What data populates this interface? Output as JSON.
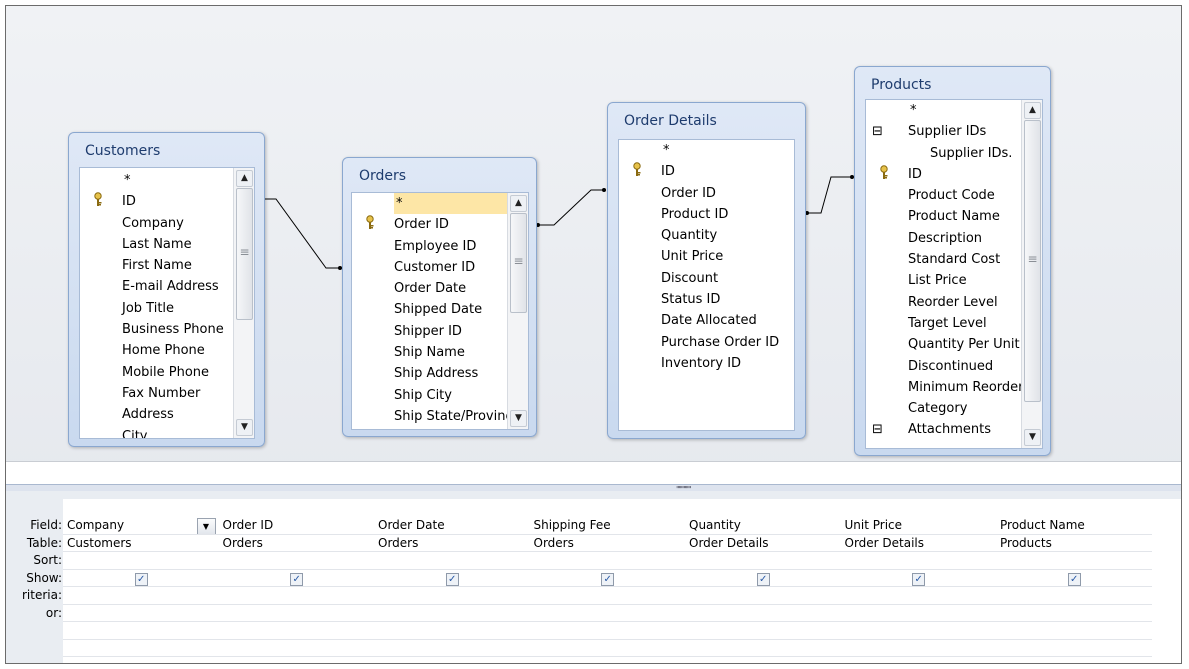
{
  "tables": [
    {
      "name": "Customers",
      "fields": [
        "*",
        "ID",
        "Company",
        "Last Name",
        "First Name",
        "E-mail Address",
        "Job Title",
        "Business Phone",
        "Home Phone",
        "Mobile Phone",
        "Fax Number",
        "Address",
        "City"
      ],
      "keys": [
        "ID"
      ]
    },
    {
      "name": "Orders",
      "fields": [
        "*",
        "Order ID",
        "Employee ID",
        "Customer ID",
        "Order Date",
        "Shipped Date",
        "Shipper ID",
        "Ship Name",
        "Ship Address",
        "Ship City",
        "Ship State/Province"
      ],
      "keys": [
        "Order ID"
      ],
      "selected": "*"
    },
    {
      "name": "Order Details",
      "fields": [
        "*",
        "ID",
        "Order ID",
        "Product ID",
        "Quantity",
        "Unit Price",
        "Discount",
        "Status ID",
        "Date Allocated",
        "Purchase Order ID",
        "Inventory ID"
      ],
      "keys": [
        "ID"
      ]
    },
    {
      "name": "Products",
      "fields": [
        "*",
        "Supplier IDs",
        "Supplier IDs.",
        "ID",
        "Product Code",
        "Product Name",
        "Description",
        "Standard Cost",
        "List Price",
        "Reorder Level",
        "Target Level",
        "Quantity Per Unit",
        "Discontinued",
        "Minimum Reorder Quantity",
        "Category",
        "Attachments"
      ],
      "keys": [
        "ID"
      ],
      "expanders": [
        "Supplier IDs",
        "Attachments"
      ]
    }
  ],
  "grid": {
    "row_labels": [
      "Field:",
      "Table:",
      "Sort:",
      "Show:",
      "riteria:",
      "or:"
    ],
    "columns": [
      {
        "field": "Company",
        "table": "Customers",
        "show": true
      },
      {
        "field": "Order ID",
        "table": "Orders",
        "show": true
      },
      {
        "field": "Order Date",
        "table": "Orders",
        "show": true
      },
      {
        "field": "Shipping Fee",
        "table": "Orders",
        "show": true
      },
      {
        "field": "Quantity",
        "table": "Order Details",
        "show": true
      },
      {
        "field": "Unit Price",
        "table": "Order Details",
        "show": true
      },
      {
        "field": "Product Name",
        "table": "Products",
        "show": true
      }
    ],
    "checkbox_glyph": "✓",
    "dropdown_glyph": "▼"
  },
  "icons": {
    "key": "key-icon",
    "scroll_up": "▲",
    "scroll_down": "▼",
    "expander": "⊟"
  },
  "colors": {
    "accent": "#c9d9ef",
    "selected_row": "#fde6a6",
    "title": "#1e3c6e"
  }
}
